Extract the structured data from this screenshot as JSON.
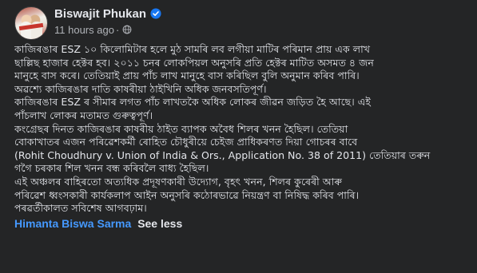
{
  "post": {
    "author": "Biswajit Phukan",
    "timestamp": "11 hours ago",
    "meta_separator": "·",
    "lines": [
      "কাজিৰঙাৰ ESZ ১০ কিলোমিটাৰ হলে মুঠ সামৰি লব লগীয়া মাটিৰ পৰিমান প্ৰায় এক লাখ",
      "ছাল্লিছ হাজাৰ হেক্টৰ হব। ২০১১ চনৰ লোকপিয়ল অনুসৰি প্ৰতি হেক্টৰ মাটিত অসমত ৪ জন",
      "মানুহে বাস কৰে। তেতিয়াই প্ৰায় পাঁচ লাখ মানুহে বাস কৰিছিল বুলি অনুমান কৰিব পাৰি।",
      "অৱশ্যে কাজিৰঙাৰ দাতি কাষৰীয়া ঠাইখিনি অধিক জনবসতিপূৰ্ণ।",
      "কাজিৰঙাৰ ESZ ৰ সীমাৰ লগত পাঁচ লাখতকৈ অধিক লোকৰ জীৱন জড়িত হৈ আছে। এই",
      "পাঁচলাখ লোকৰ মতামত গুৰুত্বপূৰ্ণ।",
      "কংগ্ৰেছৰ দিনত কাজিৰঙাৰ কাষৰীয় ঠাইত ব্যাপক অবৈধ শিলৰ খনন হৈছিল। তেতিয়া",
      "বোকাখাতৰ এজন পৰিৱেশকৰ্মী ৰোহিত চৌধুৰীয়ে চেইজ প্ৰাধিকৰণত দিয়া গোচৰৰ বাবে",
      "(Rohit Choudhury v. Union of India & Ors., Application No. 38 of 2011) তেতিয়াৰ তৰুন",
      "গগৈ চৰকাৰ শিল খনন বন্ধ কৰিবলৈ বাধ্য হৈছিল।",
      "এই অঞ্চলৰ বাহিৰতো  অত্যধিক প্ৰদূষণকাৰী উদ্যোগ, বৃহৎ খনন, শিলৰ কুৰেৰী আৰু",
      "পৰিৱেশ ধ্বংসকাৰী কাৰ্যকলাপ আইন অনুসৰি কঠোৰভাৱে নিয়ন্ত্ৰণ বা নিষিদ্ধ কৰিব পাৰি।",
      "পৰৱৰ্তীকালত সবিশেষ আগবঢ়াম।"
    ],
    "mention": "Himanta Biswa Sarma",
    "see_less": "See less"
  },
  "colors": {
    "background": "#242526",
    "text": "#e4e6eb",
    "secondary_text": "#b0b3b8",
    "link": "#4599ff",
    "verified_badge": "#1877f2"
  },
  "icons": {
    "verified": "verified-badge-icon",
    "audience": "globe-icon"
  }
}
